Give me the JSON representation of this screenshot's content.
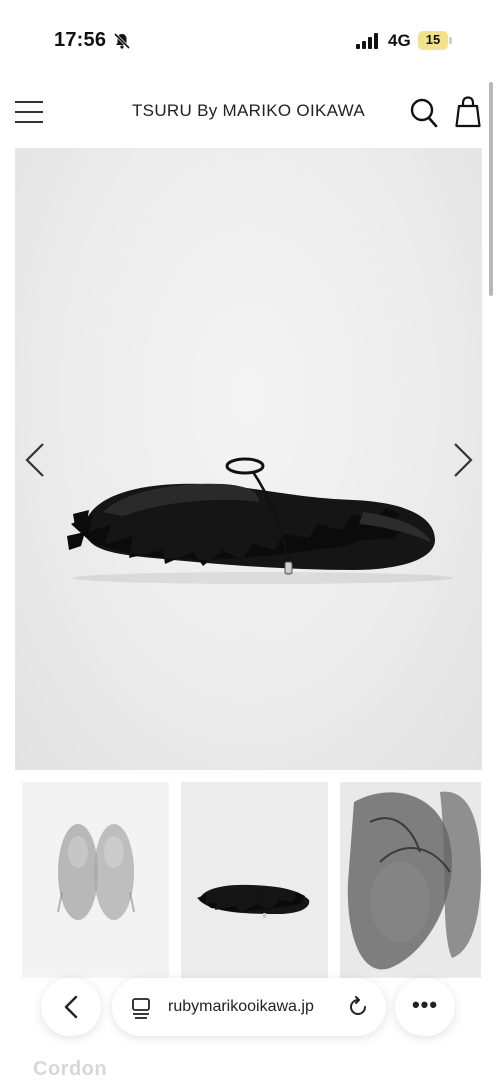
{
  "status_bar": {
    "time": "17:56",
    "network": "4G",
    "battery": "15",
    "icons": [
      "bell-slash-icon",
      "signal-icon"
    ]
  },
  "header": {
    "title": "TSURU By MARIKO OIKAWA",
    "icons": [
      "menu-icon",
      "search-icon",
      "shopping-bag-icon"
    ]
  },
  "gallery": {
    "main_image": "black satin ballet flat with ruffles and cord lace",
    "prev_icon": "chevron-left-icon",
    "next_icon": "chevron-right-icon",
    "thumbnails": [
      "top view of pair",
      "side view",
      "close-up detail"
    ]
  },
  "product": {
    "name": "Cordon"
  },
  "browser_toolbar": {
    "url": "rubymarikooikawa.jp",
    "more_label": "•••",
    "icons": [
      "back-icon",
      "tabs-icon",
      "reload-icon",
      "more-icon"
    ]
  }
}
